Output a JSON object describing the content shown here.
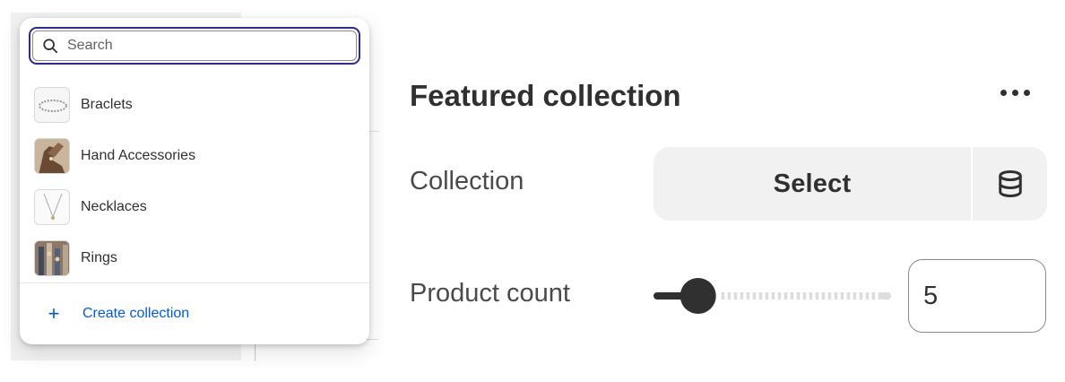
{
  "dropdown": {
    "search_placeholder": "Search",
    "items": [
      {
        "label": "Braclets",
        "thumb": "bracelet-thumb"
      },
      {
        "label": "Hand Accessories",
        "thumb": "hand-accessories-thumb"
      },
      {
        "label": "Necklaces",
        "thumb": "necklace-thumb"
      },
      {
        "label": "Rings",
        "thumb": "rings-thumb"
      }
    ],
    "create_label": "Create collection",
    "create_icon": "plus-icon"
  },
  "panel": {
    "title": "Featured collection",
    "more_icon": "more-horizontal-icon",
    "collection_label": "Collection",
    "select_label": "Select",
    "dynamic_source_icon": "database-icon",
    "product_count_label": "Product count",
    "product_count_value": "5",
    "product_count_fraction": 0.1
  },
  "colors": {
    "accent_link": "#005bd3",
    "focus_ring": "#2c2c8c",
    "text": "#303030"
  }
}
